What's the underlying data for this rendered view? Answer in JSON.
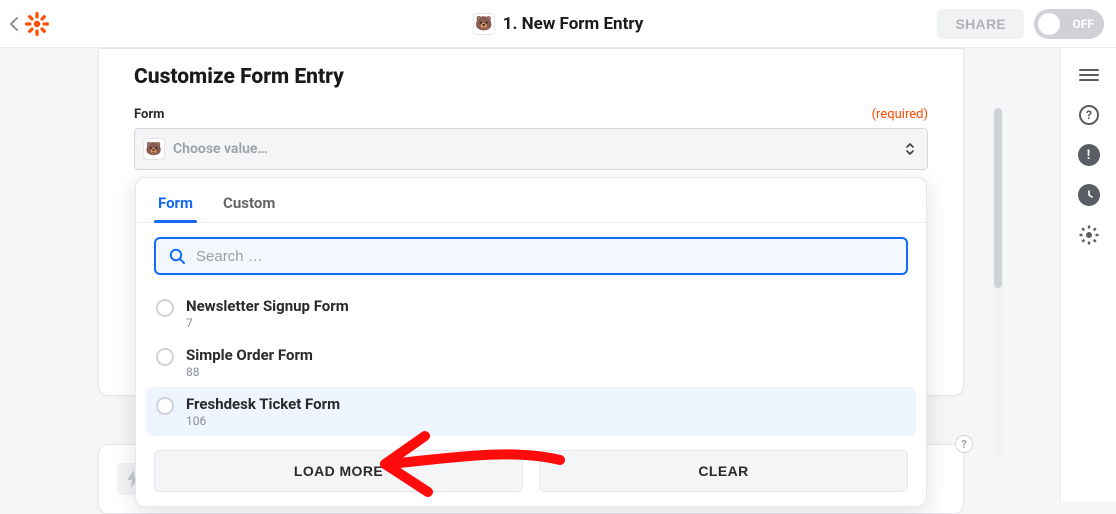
{
  "header": {
    "title": "1. New Form Entry",
    "share_label": "SHARE",
    "toggle_label": "OFF"
  },
  "card": {
    "heading": "Customize Form Entry",
    "field_label": "Form",
    "required_label": "(required)",
    "dropdown_placeholder": "Choose value…"
  },
  "popover": {
    "tabs": {
      "form": "Form",
      "custom": "Custom"
    },
    "search_placeholder": "Search …",
    "options": [
      {
        "title": "Newsletter Signup Form",
        "sub": "7"
      },
      {
        "title": "Simple Order Form",
        "sub": "88"
      },
      {
        "title": "Freshdesk Ticket Form",
        "sub": "106"
      }
    ],
    "load_more": "LOAD MORE",
    "clear": "CLEAR"
  }
}
